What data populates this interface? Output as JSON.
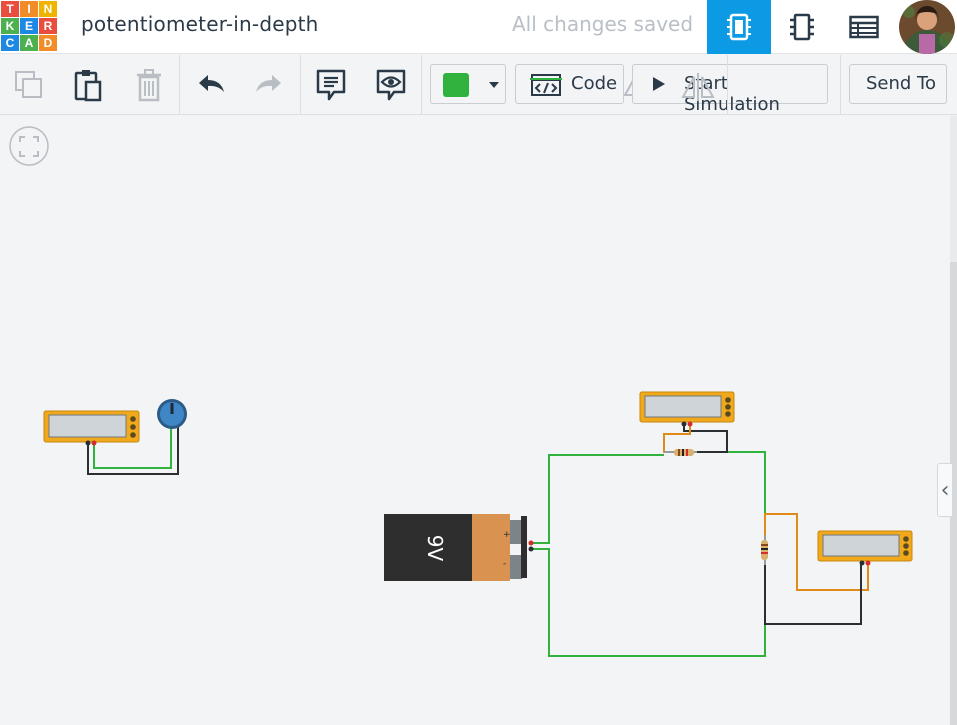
{
  "logo": {
    "letters": [
      "T",
      "I",
      "N",
      "K",
      "E",
      "R",
      "C",
      "A",
      "D"
    ]
  },
  "header": {
    "title": "potentiometer-in-depth",
    "save_status": "All changes saved"
  },
  "toolbar": {
    "code_label": "Code",
    "start_label": "Start Simulation",
    "send_label": "Send To"
  },
  "colors": {
    "accent_blue": "#0b9ae3",
    "wire_green": "#31b23f",
    "wire_orange": "#e08a17",
    "multimeter_yellow": "#f0a91b",
    "selected_color": "#31b23f"
  },
  "components": {
    "battery_label": "9V",
    "battery_plus": "+",
    "battery_minus": "-"
  },
  "icons": [
    "copy-icon",
    "paste-icon",
    "delete-icon",
    "undo-icon",
    "redo-icon",
    "notes-icon",
    "notes-visibility-icon",
    "color-icon",
    "rotate-icon",
    "mirror-icon",
    "code-icon",
    "play-icon",
    "circuit-view-icon",
    "schematic-view-icon",
    "component-list-icon",
    "fit-view-icon",
    "chevron-left-icon"
  ]
}
